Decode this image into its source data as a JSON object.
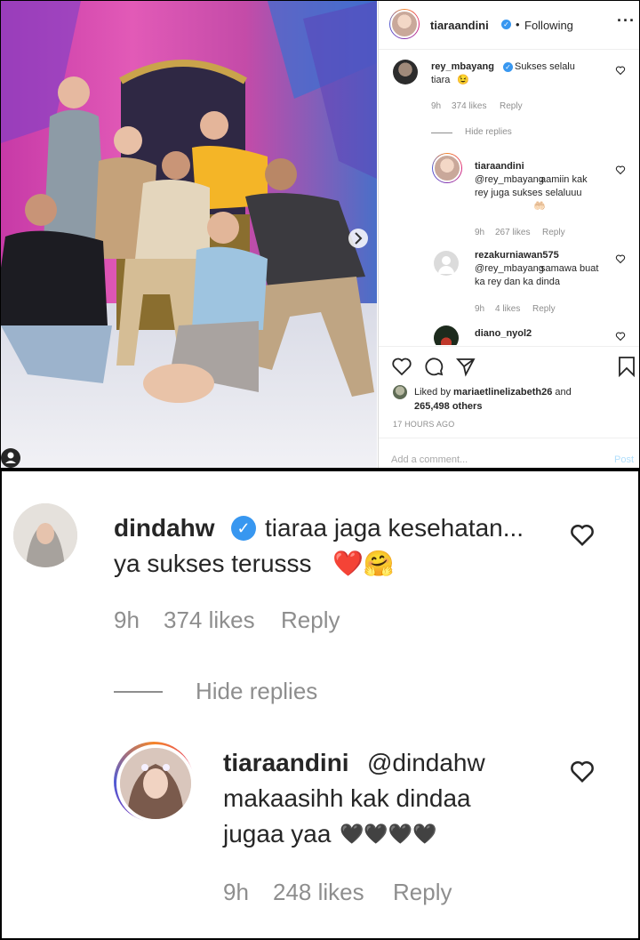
{
  "post": {
    "username": "tiaraandini",
    "follow_status": "Following",
    "more_icon": "more-horizontal-icon"
  },
  "comments": [
    {
      "username": "rey_mbayang",
      "text": "Sukses selalu tiara",
      "emoji": "😉",
      "time": "9h",
      "likes": "374 likes",
      "reply": "Reply",
      "hide_replies": "Hide replies",
      "replies": [
        {
          "username": "tiaraandini",
          "mention": "@rey_mbayang",
          "text": "aamiin kak rey juga sukses selaluuu",
          "emoji": "🤲🏻",
          "time": "9h",
          "likes": "267 likes",
          "reply": "Reply"
        },
        {
          "username": "rezakurniawan575",
          "mention": "@rey_mbayang",
          "text": "samawa buat ka rey dan ka dinda",
          "time": "9h",
          "likes": "4 likes",
          "reply": "Reply"
        }
      ]
    },
    {
      "username": "diano_nyol2"
    }
  ],
  "liked_by": {
    "prefix": "Liked by",
    "user": "mariaetlinelizabeth26",
    "and": "and",
    "others": "265,498 others"
  },
  "timestamp": "17 HOURS AGO",
  "add_comment": {
    "placeholder": "Add a comment...",
    "post_label": "Post"
  },
  "zoom": {
    "comment": {
      "username": "dindahw",
      "text_line1": "tiaraa jaga kesehatan...",
      "text_line2": "ya sukses terusss",
      "emoji": "❤️🤗",
      "time": "9h",
      "likes": "374 likes",
      "reply": "Reply"
    },
    "hide_replies": "Hide replies",
    "reply": {
      "username": "tiaraandini",
      "mention": "@dindahw",
      "text_line1": "makaasihh kak dindaa",
      "text_line2": "jugaa yaa",
      "hearts": "🖤🖤🖤🖤",
      "time": "9h",
      "likes": "248 likes",
      "reply": "Reply"
    }
  },
  "colors": {
    "link": "#00376b",
    "muted": "#8e8e8e",
    "text": "#262626",
    "verified": "#3897f0",
    "post_button": "#b2dffc"
  }
}
